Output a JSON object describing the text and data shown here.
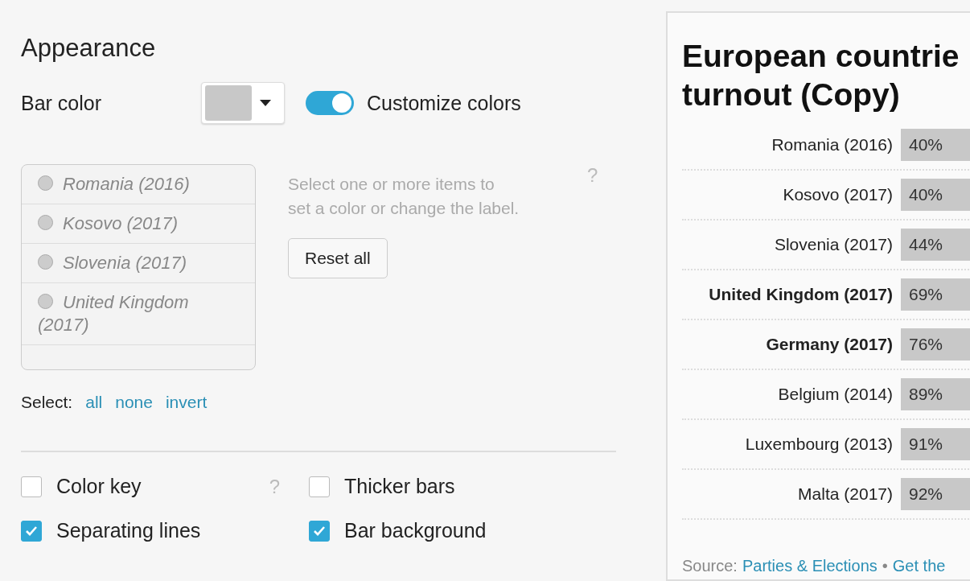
{
  "appearance": {
    "title": "Appearance",
    "bar_color": {
      "label": "Bar color",
      "color": "#c8c8c8"
    },
    "customize": {
      "label": "Customize colors",
      "on": true
    },
    "items": [
      {
        "label": "Romania (2016)",
        "selected": false
      },
      {
        "label": "Kosovo (2017)",
        "selected": false
      },
      {
        "label": "Slovenia (2017)",
        "selected": false
      },
      {
        "label": "United Kingdom (2017)",
        "selected": false
      }
    ],
    "hint": "Select one or more items to set a color or change the label.",
    "help": "?",
    "reset_button": "Reset all",
    "select": {
      "label": "Select:",
      "links": [
        "all",
        "none",
        "invert"
      ]
    },
    "options": [
      {
        "label": "Color key",
        "checked": false,
        "help": "?"
      },
      {
        "label": "Thicker bars",
        "checked": false
      },
      {
        "label": "Separating lines",
        "checked": true
      },
      {
        "label": "Bar background",
        "checked": true
      }
    ]
  },
  "chart": {
    "title_lines": [
      "European countrie",
      "turnout (Copy)"
    ],
    "rows": [
      {
        "label": "Romania (2016)",
        "value": "40%",
        "bold": false
      },
      {
        "label": "Kosovo (2017)",
        "value": "40%",
        "bold": false
      },
      {
        "label": "Slovenia (2017)",
        "value": "44%",
        "bold": false
      },
      {
        "label": "United Kingdom (2017)",
        "value": "69%",
        "bold": true
      },
      {
        "label": "Germany (2017)",
        "value": "76%",
        "bold": true
      },
      {
        "label": "Belgium (2014)",
        "value": "89%",
        "bold": false
      },
      {
        "label": "Luxembourg (2013)",
        "value": "91%",
        "bold": false
      },
      {
        "label": "Malta (2017)",
        "value": "92%",
        "bold": false
      }
    ],
    "source": {
      "label": "Source:",
      "link": "Parties & Elections",
      "separator": "•",
      "link2": "Get the"
    }
  }
}
